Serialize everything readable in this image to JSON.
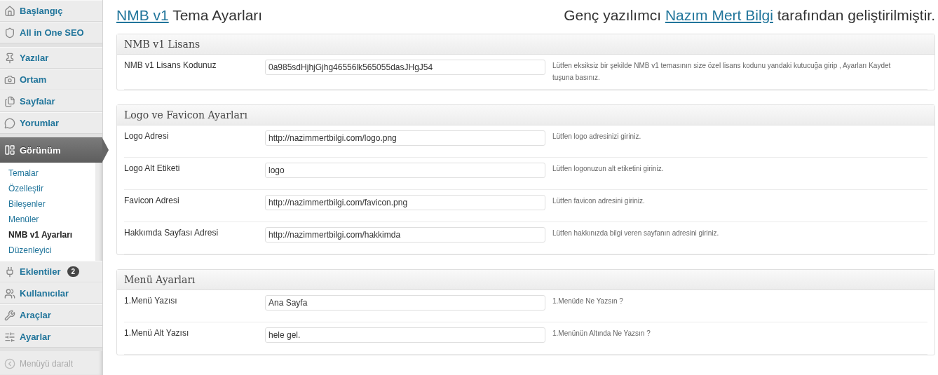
{
  "sidebar": {
    "groups": [
      [
        {
          "label": "Başlangıç",
          "selected": false
        },
        {
          "label": "All in One SEO",
          "selected": false
        }
      ],
      [
        {
          "label": "Yazılar",
          "selected": false
        },
        {
          "label": "Ortam",
          "selected": false
        },
        {
          "label": "Sayfalar",
          "selected": false
        },
        {
          "label": "Yorumlar",
          "selected": false
        }
      ],
      [
        {
          "label": "Görünüm",
          "selected": true,
          "children": [
            {
              "label": "Temalar",
              "selected": false
            },
            {
              "label": "Özelleştir",
              "selected": false
            },
            {
              "label": "Bileşenler",
              "selected": false
            },
            {
              "label": "Menüler",
              "selected": false
            },
            {
              "label": "NMB v1 Ayarları",
              "selected": true
            },
            {
              "label": "Düzenleyici",
              "selected": false
            }
          ]
        },
        {
          "label": "Eklentiler",
          "selected": false,
          "badge": "2"
        },
        {
          "label": "Kullanıcılar",
          "selected": false
        },
        {
          "label": "Araçlar",
          "selected": false
        },
        {
          "label": "Ayarlar",
          "selected": false
        }
      ]
    ],
    "collapse": "Menüyü daralt"
  },
  "header": {
    "theme_link": "NMB v1",
    "title_rest": "Tema Ayarları",
    "credit_before": "Genç yazılımcı",
    "credit_link": "Nazım Mert Bilgi",
    "credit_after": "tarafından geliştirilmiştir."
  },
  "sections": [
    {
      "title": "NMB v1 Lisans",
      "rows": [
        {
          "label": "NMB v1 Lisans Kodunuz",
          "value": "0a985sdHjhjGjhg46556lk565055dasJHgJ54",
          "help": "Lütfen eksiksiz bir şekilde NMB v1 temasının size özel lisans kodunu yandaki kutucuğa girip , Ayarları Kaydet tuşuna basınız."
        }
      ]
    },
    {
      "title": "Logo ve Favicon Ayarları",
      "rows": [
        {
          "label": "Logo Adresi",
          "value": "http://nazimmertbilgi.com/logo.png",
          "help": "Lütfen logo adresinizi giriniz."
        },
        {
          "label": "Logo Alt Etiketi",
          "value": "logo",
          "help": "Lütfen logonuzun alt etiketini giriniz."
        },
        {
          "label": "Favicon Adresi",
          "value": "http://nazimmertbilgi.com/favicon.png",
          "help": "Lütfen favicon adresini giriniz."
        },
        {
          "label": "Hakkımda Sayfası Adresi",
          "value": "http://nazimmertbilgi.com/hakkimda",
          "help": "Lütfen hakkınızda bilgi veren sayfanın adresini giriniz."
        }
      ]
    },
    {
      "title": "Menü Ayarları",
      "rows": [
        {
          "label": "1.Menü Yazısı",
          "value": "Ana Sayfa",
          "help": "1.Menüde Ne Yazsın ?"
        },
        {
          "label": "1.Menü Alt Yazısı",
          "value": "hele gel.",
          "help": "1.Menünün Altında Ne Yazsın ?"
        }
      ]
    }
  ]
}
